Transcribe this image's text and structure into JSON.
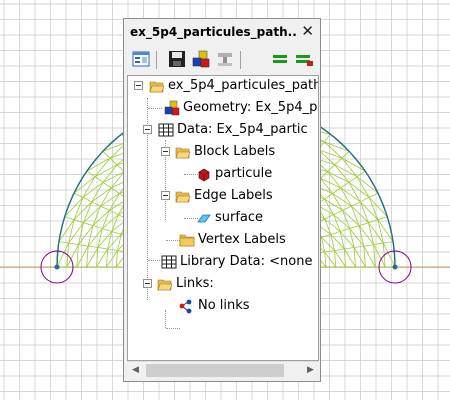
{
  "panel": {
    "title": "ex_5p4_particules_path...",
    "close_glyph": "✕"
  },
  "toolbar": {
    "buttons": [
      {
        "name": "window-icon"
      },
      {
        "name": "save-icon"
      },
      {
        "name": "materials-icon"
      },
      {
        "name": "connector-icon"
      },
      {
        "name": "equal-green-icon"
      },
      {
        "name": "equal-red-icon"
      }
    ]
  },
  "tree": {
    "root": "ex_5p4_particules_path",
    "geometry": "Geometry: Ex_5p4_p",
    "data": "Data: Ex_5p4_partic",
    "block_labels": "Block Labels",
    "particule": "particule",
    "edge_labels": "Edge Labels",
    "surface": "surface",
    "vertex_labels": "Vertex Labels",
    "library_data": "Library Data: <none",
    "links": "Links:",
    "no_links": "No links"
  },
  "scrollbar": {
    "left_arrow": "◀",
    "right_arrow": "▶"
  },
  "colors": {
    "grid": "#c8c8c8",
    "axis": "#c8a060",
    "mesh": "#9acd32",
    "boundary": "#1e6e8c",
    "circle": "#800080"
  }
}
